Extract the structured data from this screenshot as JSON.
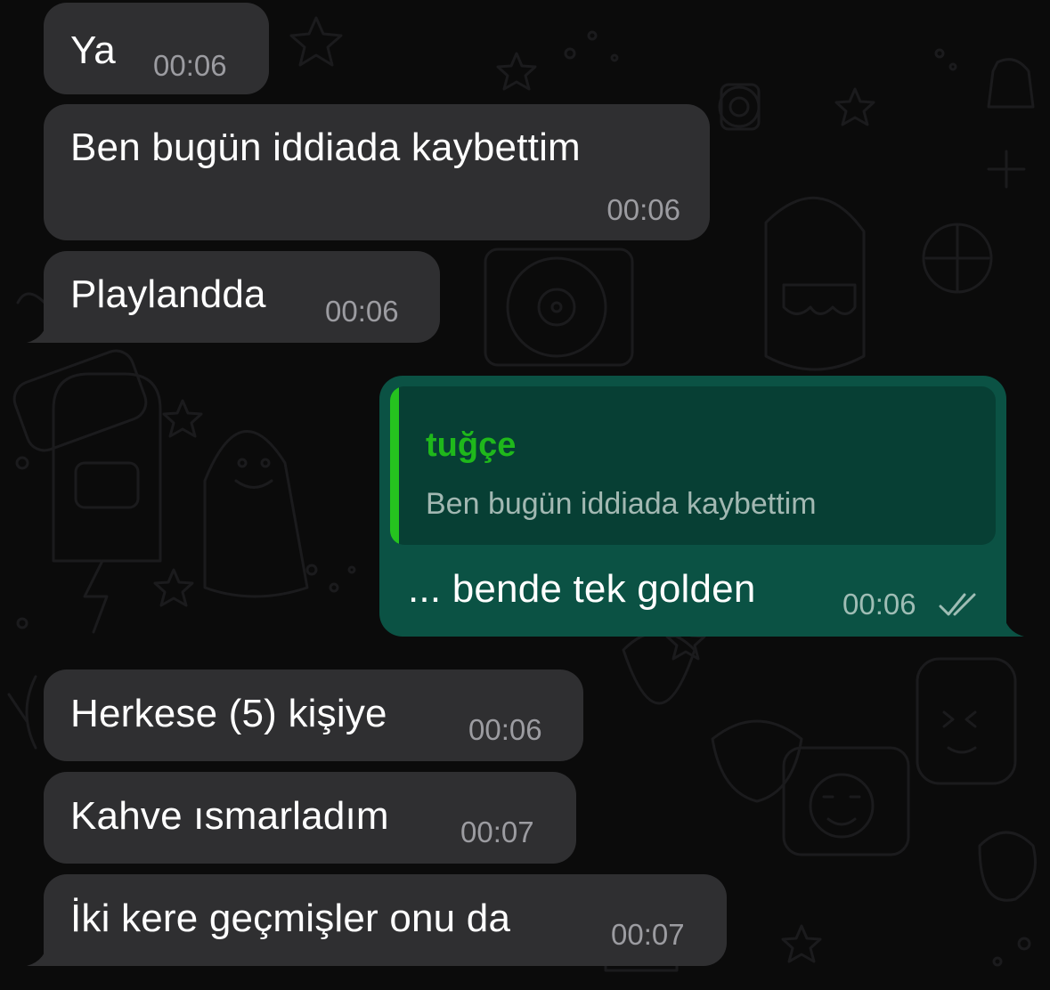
{
  "messages": [
    {
      "direction": "incoming",
      "text": "Ya",
      "time": "00:06"
    },
    {
      "direction": "incoming",
      "text": "Ben bugün iddiada kaybettim",
      "time": "00:06"
    },
    {
      "direction": "incoming",
      "text": "Playlandda",
      "time": "00:06"
    },
    {
      "direction": "outgoing",
      "reply_to": {
        "author": "tuğçe",
        "text": "Ben bugün iddiada kaybettim"
      },
      "text": "... bende tek golden",
      "time": "00:06",
      "status_icon": "double-check-read-icon"
    },
    {
      "direction": "incoming",
      "text": "Herkese (5) kişiye",
      "time": "00:06"
    },
    {
      "direction": "incoming",
      "text": "Kahve ısmarladım",
      "time": "00:07"
    },
    {
      "direction": "incoming",
      "text": "İki kere geçmişler onu da",
      "time": "00:07"
    }
  ],
  "colors": {
    "background": "#0b0b0b",
    "incoming_bubble": "#2f2f31",
    "outgoing_bubble": "#0b5244",
    "quote_background": "#073f34",
    "quote_accent": "#25c31f",
    "timestamp": "#9c9ca1"
  }
}
